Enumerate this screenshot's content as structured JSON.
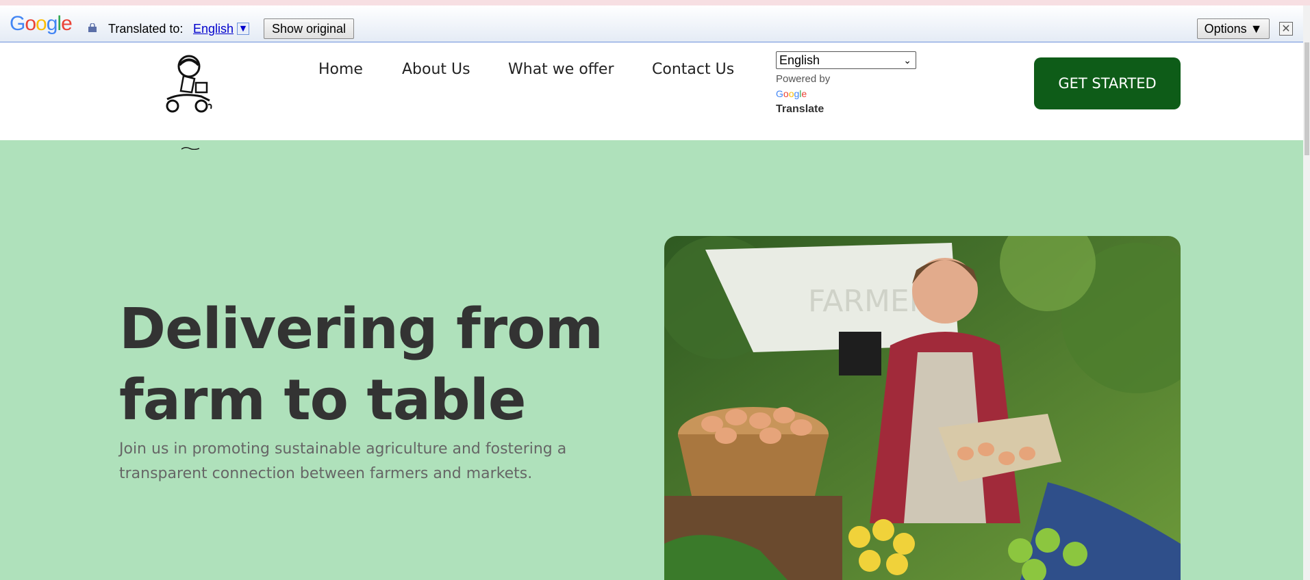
{
  "translate_bar": {
    "brand": "Google",
    "translated_label": "Translated to:",
    "language": "English",
    "show_original": "Show original",
    "options": "Options ▼",
    "close_glyph": "✕"
  },
  "header": {
    "nav": [
      "Home",
      "About Us",
      "What we offer",
      "Contact Us"
    ],
    "language_select": {
      "selected": "English"
    },
    "powered_by": "Powered by",
    "google_small": "Google",
    "translate_label": "Translate",
    "cta_label": "GET STARTED"
  },
  "hero": {
    "title_line1": "Delivering from",
    "title_line2": "farm to table",
    "subtitle": "Join us in promoting sustainable agriculture and fostering a transparent connection between farmers and markets.",
    "image_alt": "Farmer handing eggs at market stall"
  },
  "colors": {
    "hero_bg": "#afe1bb",
    "cta_bg": "#0e5c18",
    "heading": "#333333"
  }
}
